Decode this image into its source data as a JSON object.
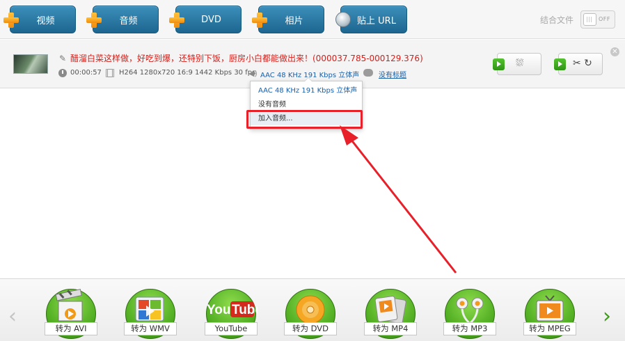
{
  "toolbar": {
    "buttons": [
      {
        "label": "视频",
        "icon": "plus-icon"
      },
      {
        "label": "音频",
        "icon": "plus-icon"
      },
      {
        "label": "DVD",
        "icon": "plus-icon"
      },
      {
        "label": "相片",
        "icon": "plus-icon"
      },
      {
        "label": "贴上 URL",
        "icon": "globe-icon"
      }
    ],
    "merge_label": "结合文件",
    "merge_toggle": "OFF"
  },
  "file": {
    "title": "醋溜白菜这样做，好吃到爆，还特别下饭，厨房小白都能做出来！(000037.785-000129.376)",
    "duration": "00:00:57",
    "video_info": "H264  1280x720  16:9  1442 Kbps  30 fps",
    "audio_info": "AAC  48 KHz  191 Kbps  立体声",
    "subtitle": "没有标题"
  },
  "audio_menu": {
    "items": [
      "AAC  48 KHz  191 Kbps  立体声",
      "没有音频",
      "加入音频..."
    ],
    "selected_index": 2
  },
  "formats": [
    {
      "label": "转为 AVI",
      "icon": "clapperboard-icon"
    },
    {
      "label": "转为 WMV",
      "icon": "windows-media-icon"
    },
    {
      "label": "YouTube",
      "icon": "youtube-icon",
      "logo_text_1": "You",
      "logo_text_2": "Tube"
    },
    {
      "label": "转为 DVD",
      "icon": "disc-icon"
    },
    {
      "label": "转为 MP4",
      "icon": "mp4-player-icon"
    },
    {
      "label": "转为 MP3",
      "icon": "earphones-icon"
    },
    {
      "label": "转为 MPEG",
      "icon": "tv-icon"
    }
  ],
  "colors": {
    "toolbar_button": "#2a7aa6",
    "title_red": "#d4201b",
    "link_blue": "#1b5fa6",
    "format_green": "#4aa81d",
    "annotation_red": "#e8202a"
  }
}
